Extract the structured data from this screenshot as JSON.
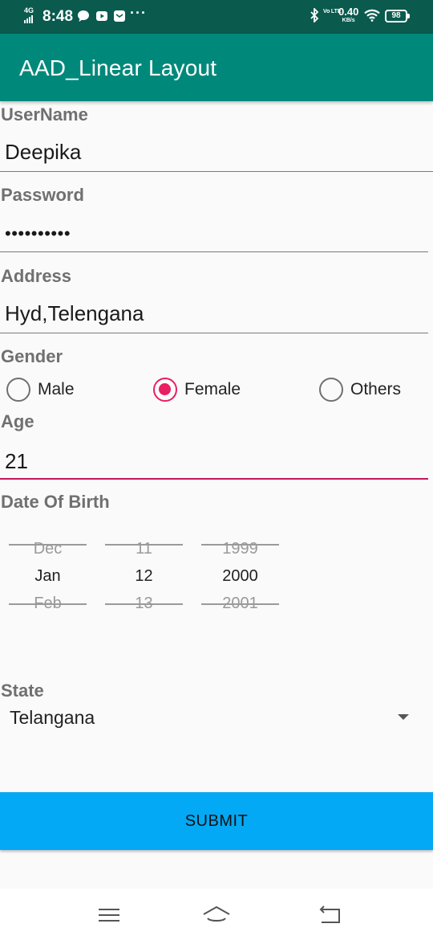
{
  "status_bar": {
    "network": "4G",
    "time": "8:48",
    "more": "···",
    "volte": "Vo LTE",
    "speed_value": "0.40",
    "speed_unit": "KB/s",
    "battery": "98",
    "icons": [
      "signal-icon",
      "chat-icon",
      "youtube-icon",
      "mail-icon",
      "bluetooth-icon",
      "wifi-icon",
      "battery-icon"
    ]
  },
  "app_bar": {
    "title": "AAD_Linear Layout",
    "color": "#00897b"
  },
  "form": {
    "username": {
      "label": "UserName",
      "value": "Deepika"
    },
    "password": {
      "label": "Password",
      "value": "••••••••••"
    },
    "address": {
      "label": "Address",
      "value": "Hyd,Telengana"
    },
    "gender": {
      "label": "Gender",
      "options": [
        {
          "label": "Male",
          "selected": false
        },
        {
          "label": "Female",
          "selected": true
        },
        {
          "label": "Others",
          "selected": false
        }
      ]
    },
    "age": {
      "label": "Age",
      "value": "21"
    },
    "dob": {
      "label": "Date Of Birth",
      "month": {
        "prev": "Dec",
        "current": "Jan",
        "next": "Feb"
      },
      "day": {
        "prev": "11",
        "current": "12",
        "next": "13"
      },
      "year": {
        "prev": "1999",
        "current": "2000",
        "next": "2001"
      }
    },
    "state": {
      "label": "State",
      "value": "Telangana"
    },
    "submit_label": "SUBMIT"
  },
  "colors": {
    "accent": "#e91e63",
    "focus_underline": "#c2185b",
    "submit_bg": "#03a9f4",
    "status_bar": "#0a5a4e"
  },
  "nav": {
    "icons": [
      "menu-icon",
      "home-icon",
      "back-icon"
    ]
  }
}
